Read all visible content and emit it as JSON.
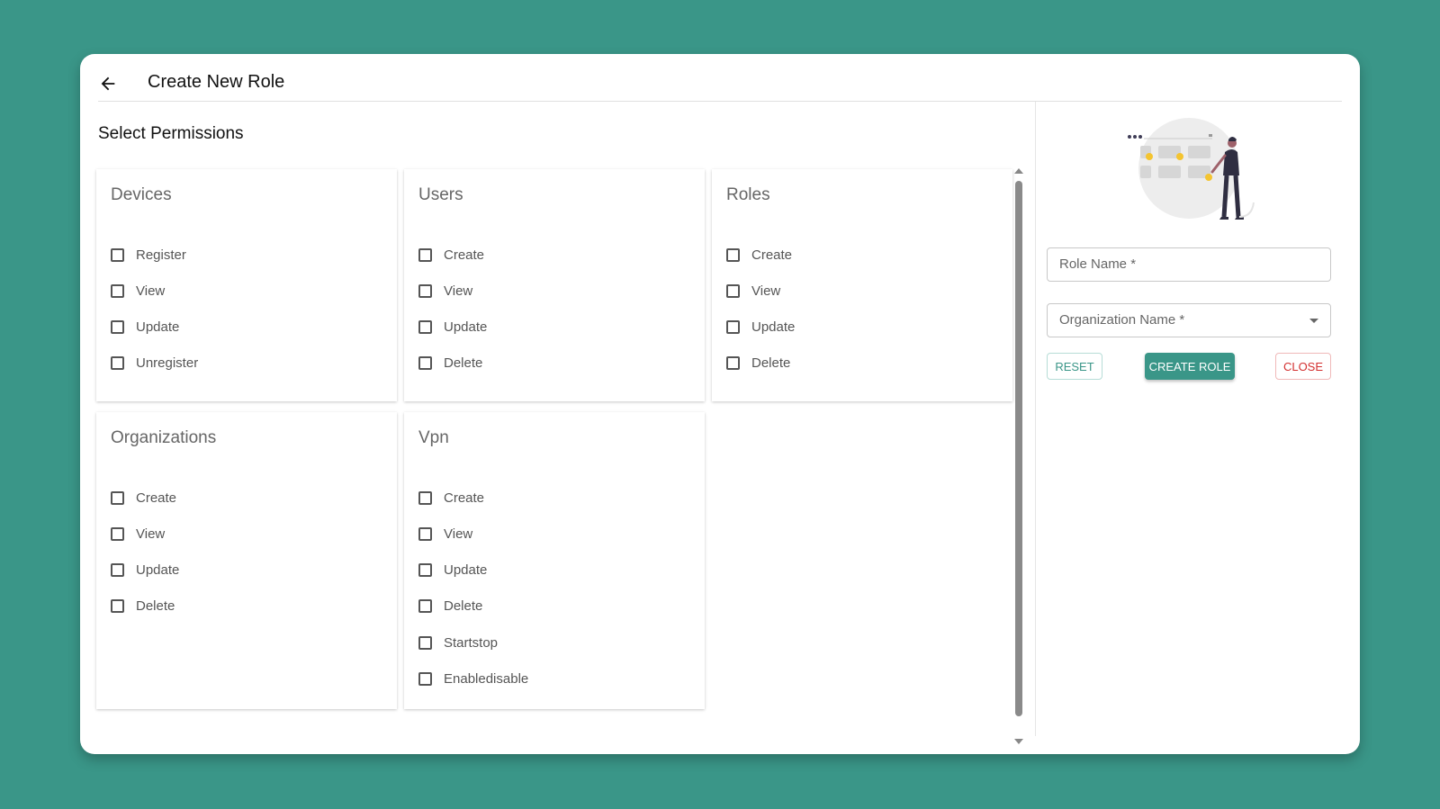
{
  "header": {
    "title": "Create New Role"
  },
  "permissions": {
    "section_title": "Select Permissions",
    "cards": [
      {
        "title": "Devices",
        "items": [
          "Register",
          "View",
          "Update",
          "Unregister"
        ]
      },
      {
        "title": "Users",
        "items": [
          "Create",
          "View",
          "Update",
          "Delete"
        ]
      },
      {
        "title": "Roles",
        "items": [
          "Create",
          "View",
          "Update",
          "Delete"
        ]
      },
      {
        "title": "Organizations",
        "items": [
          "Create",
          "View",
          "Update",
          "Delete"
        ]
      },
      {
        "title": "Vpn",
        "items": [
          "Create",
          "View",
          "Update",
          "Delete",
          "Startstop",
          "Enabledisable"
        ]
      }
    ]
  },
  "form": {
    "role_name_label": "Role Name *",
    "organization_label": "Organization Name *",
    "reset_label": "RESET",
    "create_label": "CREATE ROLE",
    "close_label": "CLOSE"
  },
  "colors": {
    "accent": "#3a9688",
    "danger": "#d32f2f"
  }
}
